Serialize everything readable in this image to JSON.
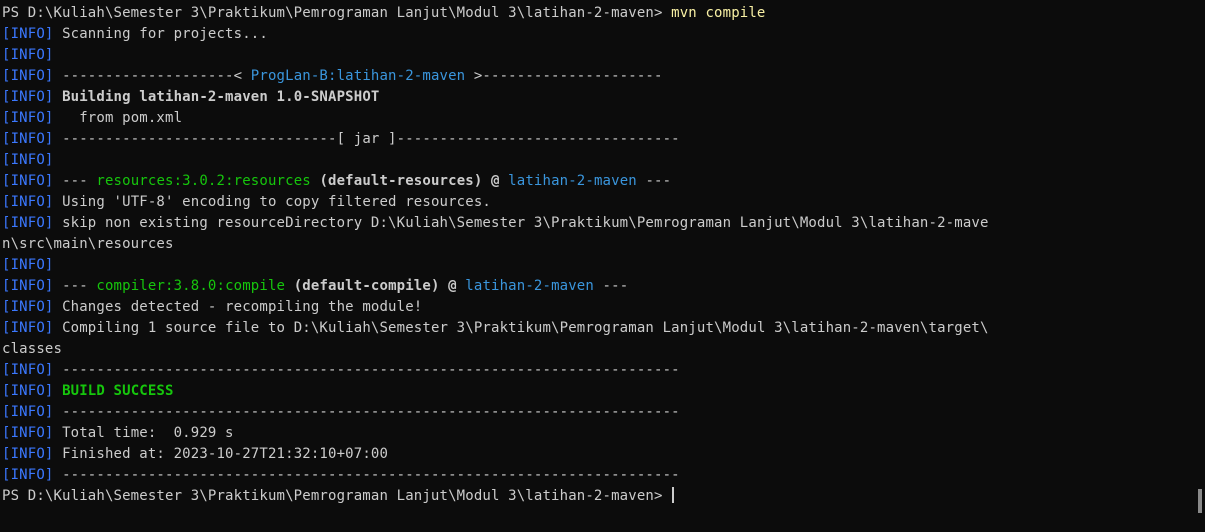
{
  "terminal": {
    "prompt": "PS D:\\Kuliah\\Semester 3\\Praktikum\\Pemrograman Lanjut\\Modul 3\\latihan-2-maven> ",
    "command": "mvn compile",
    "info_tag": "[INFO]",
    "lines": {
      "l2": " Scanning for projects...",
      "l4a": " --------------------< ",
      "l4b": "ProgLan-B:latihan-2-maven",
      "l4c": " >---------------------",
      "l5": " Building latihan-2-maven 1.0-SNAPSHOT",
      "l6": "   from pom.xml",
      "l7": " --------------------------------[ jar ]---------------------------------",
      "l9a": " --- ",
      "l9b": "resources:3.0.2:resources",
      "l9c": " (default-resources) @ ",
      "l9d": "latihan-2-maven",
      "l9e": " ---",
      "l10": " Using 'UTF-8' encoding to copy filtered resources.",
      "l11": " skip non existing resourceDirectory D:\\Kuliah\\Semester 3\\Praktikum\\Pemrograman Lanjut\\Modul 3\\latihan-2-mave",
      "l12": "n\\src\\main\\resources",
      "l14a": " --- ",
      "l14b": "compiler:3.8.0:compile",
      "l14c": " (default-compile) @ ",
      "l14d": "latihan-2-maven",
      "l14e": " ---",
      "l15": " Changes detected - recompiling the module!",
      "l16": " Compiling 1 source file to D:\\Kuliah\\Semester 3\\Praktikum\\Pemrograman Lanjut\\Modul 3\\latihan-2-maven\\target\\",
      "l17": "classes",
      "sep": " ------------------------------------------------------------------------",
      "l19": " BUILD SUCCESS",
      "l21": " Total time:  0.929 s",
      "l22": " Finished at: 2023-10-27T21:32:10+07:00"
    }
  },
  "colors": {
    "background": "#0c0c0c",
    "text": "#cccccc",
    "info": "#3b78ff",
    "command": "#f9f1a5",
    "success": "#16c60c",
    "artifact": "#3a96dd"
  }
}
